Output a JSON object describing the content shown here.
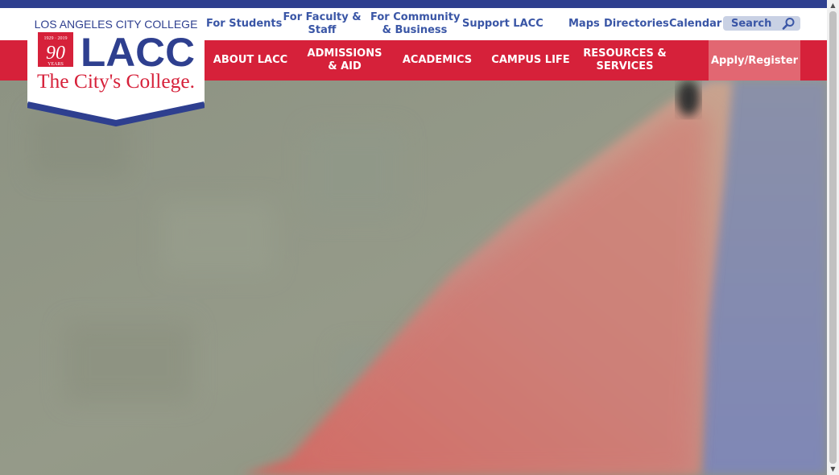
{
  "logo": {
    "institution": "LOS ANGELES CITY COLLEGE",
    "abbrev": "LACC",
    "years_range": "1929 · 2019",
    "anniversary_number": "90",
    "anniversary_word": "YEARS",
    "tagline": "The City's College."
  },
  "utility_nav": {
    "for_students": "For Students",
    "faculty_line1": "For Faculty &",
    "faculty_line2": "Staff",
    "community_line1": "For Community",
    "community_line2": "& Business",
    "support": "Support LACC",
    "maps": "Maps",
    "directories": "Directories",
    "calendar": "Calendar"
  },
  "search": {
    "placeholder": "Search"
  },
  "main_nav": {
    "about": "ABOUT LACC",
    "admissions_line1": "ADMISSIONS",
    "admissions_line2": "& AID",
    "academics": "ACADEMICS",
    "campus_life": "CAMPUS LIFE",
    "resources_line1": "RESOURCES &",
    "resources_line2": "SERVICES",
    "apply": "Apply/Register"
  },
  "colors": {
    "brand_blue": "#2e3f8f",
    "link_blue": "#3a56a6",
    "brand_red": "#d6213a",
    "apply_pink": "#e26772"
  },
  "icons": {
    "search": "search-icon",
    "scroll_up": "scroll-up-arrow-icon",
    "scroll_down": "scroll-down-arrow-icon"
  }
}
